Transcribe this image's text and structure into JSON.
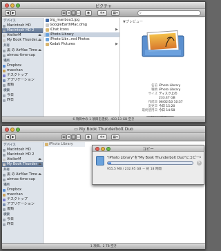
{
  "window1": {
    "title": "ピクチャ",
    "search_placeholder": "",
    "sidebar": [
      {
        "section": "デバイス",
        "items": [
          {
            "label": "Macintosh HD",
            "selected": false,
            "color": "#9aa3ad",
            "eject": false
          },
          {
            "label": "Macintosh HD 2",
            "selected": true,
            "color": "#9aa3ad",
            "eject": false
          },
          {
            "label": "AtelierM",
            "selected": false,
            "color": "#c7c7c7",
            "eject": true
          },
          {
            "label": "My Book Thunder...",
            "selected": false,
            "color": "#c7c7c7",
            "eject": true
          }
        ]
      },
      {
        "section": "共有",
        "items": [
          {
            "label": "黒 の AirMac Time ...",
            "selected": false,
            "color": "#9aa3ad",
            "eject": true
          },
          {
            "label": "airmac-time-cap",
            "selected": false,
            "color": "#9aa3ad",
            "eject": false
          }
        ]
      },
      {
        "section": "場所",
        "items": [
          {
            "label": "Dropbox",
            "selected": false,
            "color": "#5b8fd6",
            "eject": false
          },
          {
            "label": "macchan",
            "selected": false,
            "color": "#c9a15b",
            "eject": false
          },
          {
            "label": "デスクトップ",
            "selected": false,
            "color": "#7a7fd1",
            "eject": false
          },
          {
            "label": "アプリケーション",
            "selected": false,
            "color": "#7a8fb2",
            "eject": false
          },
          {
            "label": "書類",
            "selected": false,
            "color": "#9aa3ad",
            "eject": false
          }
        ]
      },
      {
        "section": "検索",
        "items": [
          {
            "label": "今日",
            "selected": false,
            "color": "#a0a8b4",
            "eject": false
          },
          {
            "label": "昨日",
            "selected": false,
            "color": "#a0a8b4",
            "eject": false
          }
        ]
      }
    ],
    "files": [
      {
        "label": "big_manbou1.jpg",
        "selected": false,
        "color": "#3f6aa8",
        "arrow": false
      },
      {
        "label": "GoogleEarthMac.dmg",
        "selected": false,
        "color": "#c8c8c8",
        "arrow": false
      },
      {
        "label": "iChat Icons",
        "selected": false,
        "color": "#d8b56f",
        "arrow": true
      },
      {
        "label": "iPhoto Library",
        "selected": true,
        "color": "#6aa2dc",
        "arrow": false
      },
      {
        "label": "iPhoto Libr...red Photos",
        "selected": false,
        "color": "#6aa2dc",
        "arrow": false
      },
      {
        "label": "Kodak Pictures",
        "selected": false,
        "color": "#d8b56f",
        "arrow": true
      }
    ],
    "preview": {
      "header": "▼プレビュー",
      "rows": [
        {
          "key": "名前",
          "value": "iPhoto Library"
        },
        {
          "key": "種類",
          "value": "iPhoto Library"
        },
        {
          "key": "サイズ",
          "value": "ディスク上の"
        },
        {
          "key": "",
          "value": "233.47 GB"
        },
        {
          "key": "作成日",
          "value": "06/02/10 10:37"
        },
        {
          "key": "変更日",
          "value": "今日 15:20"
        },
        {
          "key": "最終使用日",
          "value": "今日 14:58"
        }
      ],
      "more_button": "詳しい情報..."
    },
    "status": "6 項目中の 1 項目を選択、403.13 GB 空き"
  },
  "window2": {
    "title": "My Book Thunderbolt Duo",
    "sidebar": [
      {
        "section": "デバイス",
        "items": [
          {
            "label": "Macintosh HD",
            "selected": false,
            "color": "#9aa3ad",
            "eject": false
          },
          {
            "label": "Macintosh HD 2",
            "selected": false,
            "color": "#9aa3ad",
            "eject": false
          },
          {
            "label": "AtelierM",
            "selected": false,
            "color": "#c7c7c7",
            "eject": true
          },
          {
            "label": "My Book Thunder",
            "selected": true,
            "color": "#c7c7c7",
            "eject": true
          }
        ]
      },
      {
        "section": "共有",
        "items": [
          {
            "label": "黒 の AirMac Time ...",
            "selected": false,
            "color": "#9aa3ad",
            "eject": true
          },
          {
            "label": "airmac-time-cap",
            "selected": false,
            "color": "#9aa3ad",
            "eject": false
          }
        ]
      },
      {
        "section": "場所",
        "items": [
          {
            "label": "Dropbox",
            "selected": false,
            "color": "#5b8fd6",
            "eject": false
          },
          {
            "label": "macchan",
            "selected": false,
            "color": "#c9a15b",
            "eject": false
          },
          {
            "label": "デスクトップ",
            "selected": false,
            "color": "#7a7fd1",
            "eject": false
          },
          {
            "label": "アプリケーション",
            "selected": false,
            "color": "#7a8fb2",
            "eject": false
          },
          {
            "label": "書類",
            "selected": false,
            "color": "#9aa3ad",
            "eject": false
          }
        ]
      },
      {
        "section": "検索",
        "items": [
          {
            "label": "今日",
            "selected": false,
            "color": "#a0a8b4",
            "eject": false
          },
          {
            "label": "昨日",
            "selected": false,
            "color": "#a0a8b4",
            "eject": false
          }
        ]
      }
    ],
    "column_item": "iPhoto Library",
    "status": "1 項目、2 TB 空き"
  },
  "copy_dialog": {
    "title": "コピー",
    "message": "\"iPhoto Library\"を\"My Book Thunderbolt Duo\"にコピー中",
    "progress": 0.04,
    "info": "955.5 MB / 232.95 GB － 約 18 時間"
  }
}
